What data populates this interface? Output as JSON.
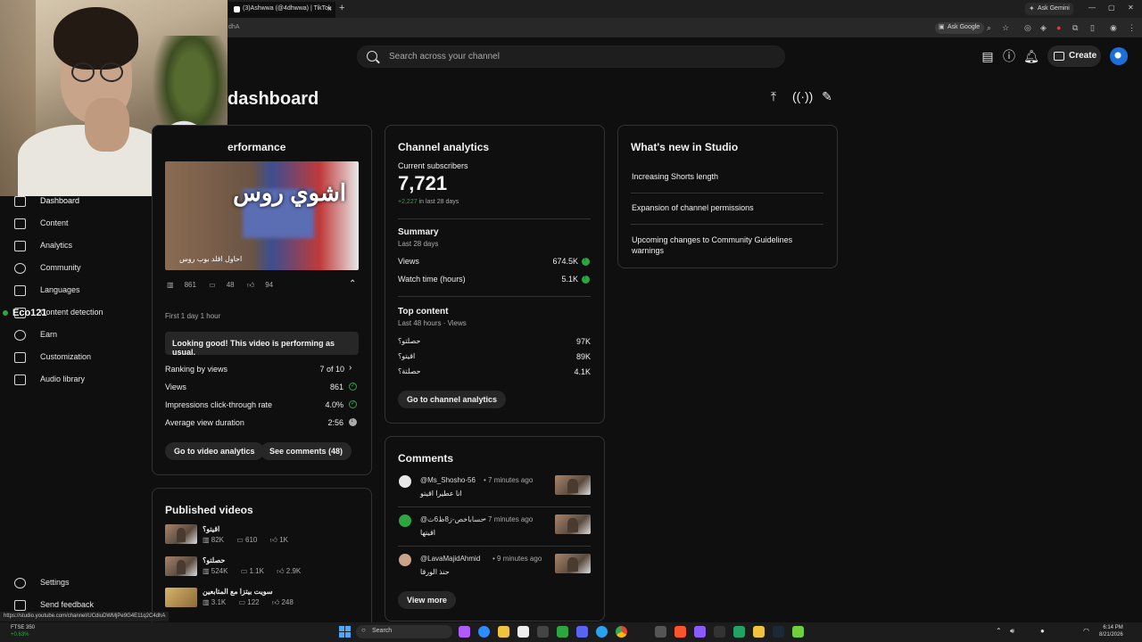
{
  "browser": {
    "tab_title": "(3)Ashwwa (@4dhwwa) | TikTok",
    "gemini_tab": "Ask Gemini",
    "url_fragment": "dhA",
    "ask_google": "Ask Google",
    "status_url": "https://studio.youtube.com/channel/UCdiuDWMjPe9G4E11q2C4dhA"
  },
  "header": {
    "search_placeholder": "Search across your channel",
    "create_label": "Create"
  },
  "page": {
    "title": "dashboard"
  },
  "sidebar": {
    "items": [
      {
        "label": "Dashboard",
        "icon": "dashboard-icon"
      },
      {
        "label": "Content",
        "icon": "content-icon"
      },
      {
        "label": "Analytics",
        "icon": "analytics-icon"
      },
      {
        "label": "Community",
        "icon": "community-icon"
      },
      {
        "label": "Languages",
        "icon": "languages-icon"
      },
      {
        "label": "Content detection",
        "icon": "content-detection-icon"
      },
      {
        "label": "Earn",
        "icon": "earn-icon"
      },
      {
        "label": "Customization",
        "icon": "customization-icon"
      },
      {
        "label": "Audio library",
        "icon": "audio-library-icon"
      }
    ],
    "settings": "Settings",
    "feedback": "Send feedback"
  },
  "overlay": {
    "eco_label": "Eco121"
  },
  "video_performance": {
    "title": "erformance",
    "thumb_caption": "احاول اقلد بوب روس",
    "thumb_overlay": "اشوي روس",
    "views": "861",
    "comments": "48",
    "likes": "94",
    "period": "First 1 day 1 hour",
    "message": "Looking good! This video is performing as usual.",
    "rows": [
      {
        "label": "Ranking by views",
        "value": "7 of 10"
      },
      {
        "label": "Views",
        "value": "861"
      },
      {
        "label": "Impressions click-through rate",
        "value": "4.0%"
      },
      {
        "label": "Average view duration",
        "value": "2:56"
      }
    ],
    "btn_analytics": "Go to video analytics",
    "btn_comments": "See comments (48)"
  },
  "channel_analytics": {
    "title": "Channel analytics",
    "subs_label": "Current subscribers",
    "subs_value": "7,721",
    "subs_change": "+2,227",
    "subs_period": " in last 28 days",
    "summary_title": "Summary",
    "summary_period": "Last 28 days",
    "views_label": "Views",
    "views_value": "674.5K",
    "watch_label": "Watch time (hours)",
    "watch_value": "5.1K",
    "top_title": "Top content",
    "top_period": "Last 48 hours · Views",
    "top_items": [
      {
        "title": "حصلتو؟",
        "value": "97K"
      },
      {
        "title": "اقيتو؟",
        "value": "89K"
      },
      {
        "title": "حصلتة؟",
        "value": "4.1K"
      }
    ],
    "btn": "Go to channel analytics"
  },
  "whats_new": {
    "title": "What's new in Studio",
    "items": [
      "Increasing Shorts length",
      "Expansion of channel permissions",
      "Upcoming changes to Community Guidelines warnings"
    ]
  },
  "published": {
    "title": "Published videos",
    "items": [
      {
        "title": "اقيتو؟",
        "views": "82K",
        "comments": "610",
        "likes": "1K"
      },
      {
        "title": "حصلتو؟",
        "views": "524K",
        "comments": "1.1K",
        "likes": "2.9K"
      },
      {
        "title": "سويت بيتزا مع المتابعين",
        "views": "3.1K",
        "comments": "122",
        "likes": "248"
      }
    ]
  },
  "comments": {
    "title": "Comments",
    "items": [
      {
        "author": "@Ms_Shosho-56",
        "time": "• 7 minutes ago",
        "text": "انا عطيرا اقيتو",
        "avatar_color": "#e8e8e8"
      },
      {
        "author": "@حساباخص-ز8ظ6ث",
        "time": "• 7 minutes ago",
        "text": "اقيتها",
        "avatar_color": "#2ba640"
      },
      {
        "author": "@LavaMajidAhmid",
        "time": "• 9 minutes ago",
        "text": "حنذ الورقا",
        "avatar_color": "#c9a48a"
      }
    ],
    "btn": "View more"
  },
  "taskbar": {
    "search": "Search",
    "ticker_name": "FTSE 350",
    "ticker_change": "+0.63%",
    "time": "6:14 PM",
    "date": "8/21/2026"
  }
}
